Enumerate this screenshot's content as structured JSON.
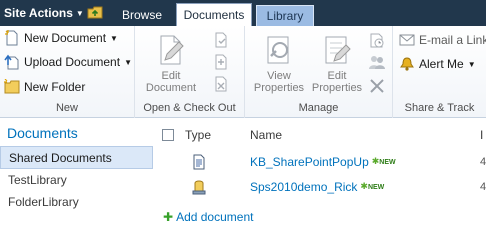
{
  "topbar": {
    "site_actions": "Site Actions",
    "tabs": [
      {
        "label": "Browse"
      },
      {
        "label": "Documents"
      },
      {
        "label": "Library"
      }
    ]
  },
  "ribbon": {
    "new_group": {
      "label": "New",
      "new_document": "New Document",
      "upload_document": "Upload Document",
      "new_folder": "New Folder"
    },
    "open_group": {
      "label": "Open & Check Out",
      "edit_document_line1": "Edit",
      "edit_document_line2": "Document"
    },
    "manage_group": {
      "label": "Manage",
      "view_properties_line1": "View",
      "view_properties_line2": "Properties",
      "edit_properties_line1": "Edit",
      "edit_properties_line2": "Properties"
    },
    "share_group": {
      "label": "Share & Track",
      "email_link": "E-mail a Link",
      "alert_me": "Alert Me"
    }
  },
  "leftnav": {
    "heading": "Documents",
    "items": [
      {
        "label": "Shared Documents",
        "selected": true
      },
      {
        "label": "TestLibrary"
      },
      {
        "label": "FolderLibrary"
      }
    ]
  },
  "list": {
    "columns": {
      "type": "Type",
      "name": "Name",
      "trailing": "I"
    },
    "rows": [
      {
        "name": "KB_SharePointPopUp",
        "badge": "NEW",
        "trailing": "4",
        "icon": "document-icon"
      },
      {
        "name": "Sps2010demo_Rick",
        "badge": "NEW",
        "trailing": "4",
        "icon": "site-template-icon"
      }
    ],
    "add_document": "Add document"
  },
  "colors": {
    "topbar": "#21374c",
    "link": "#0072bc",
    "selected_nav": "#dbe8f8",
    "new_badge": "#2d7c16"
  }
}
